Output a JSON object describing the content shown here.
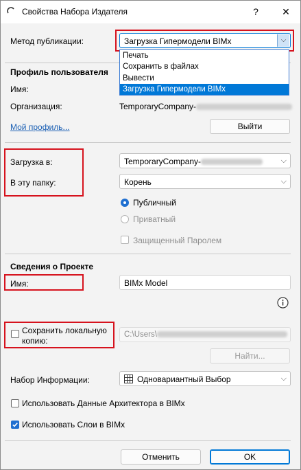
{
  "window": {
    "title": "Свойства Набора Издателя",
    "help_label": "?",
    "close_label": "✕"
  },
  "publish_method": {
    "label": "Метод публикации:",
    "selected": "Загрузка Гипермодели BIMx",
    "options": [
      "Печать",
      "Сохранить в файлах",
      "Вывести",
      "Загрузка Гипермодели BIMx"
    ]
  },
  "profile": {
    "heading": "Профиль пользователя",
    "name_label": "Имя:",
    "org_label": "Организация:",
    "org_value": "TemporaryCompany-",
    "my_profile_link": "Мой профиль...",
    "logout_button": "Выйти"
  },
  "upload": {
    "upload_to_label": "Загрузка в:",
    "upload_to_value": "TemporaryCompany-",
    "folder_label": "В эту папку:",
    "folder_value": "Корень",
    "public_label": "Публичный",
    "private_label": "Приватный",
    "password_label": "Защищенный Паролем"
  },
  "project": {
    "heading": "Сведения о Проекте",
    "name_label": "Имя:",
    "name_value": "BIMx Model",
    "info_icon": "info-icon"
  },
  "local_copy": {
    "label": "Сохранить локальную копию:",
    "path_value": "C:\\Users\\",
    "browse_button": "Найти..."
  },
  "info_set": {
    "label": "Набор Информации:",
    "value": "Одновариантный Выбор"
  },
  "options": {
    "use_architect_data": "Использовать Данные Архитектора в BIMx",
    "use_layers": "Использовать Слои в BIMx"
  },
  "footer": {
    "cancel_button": "Отменить",
    "ok_button": "OK"
  },
  "colors": {
    "accent": "#0078d7",
    "highlight_box": "#d6121d"
  }
}
